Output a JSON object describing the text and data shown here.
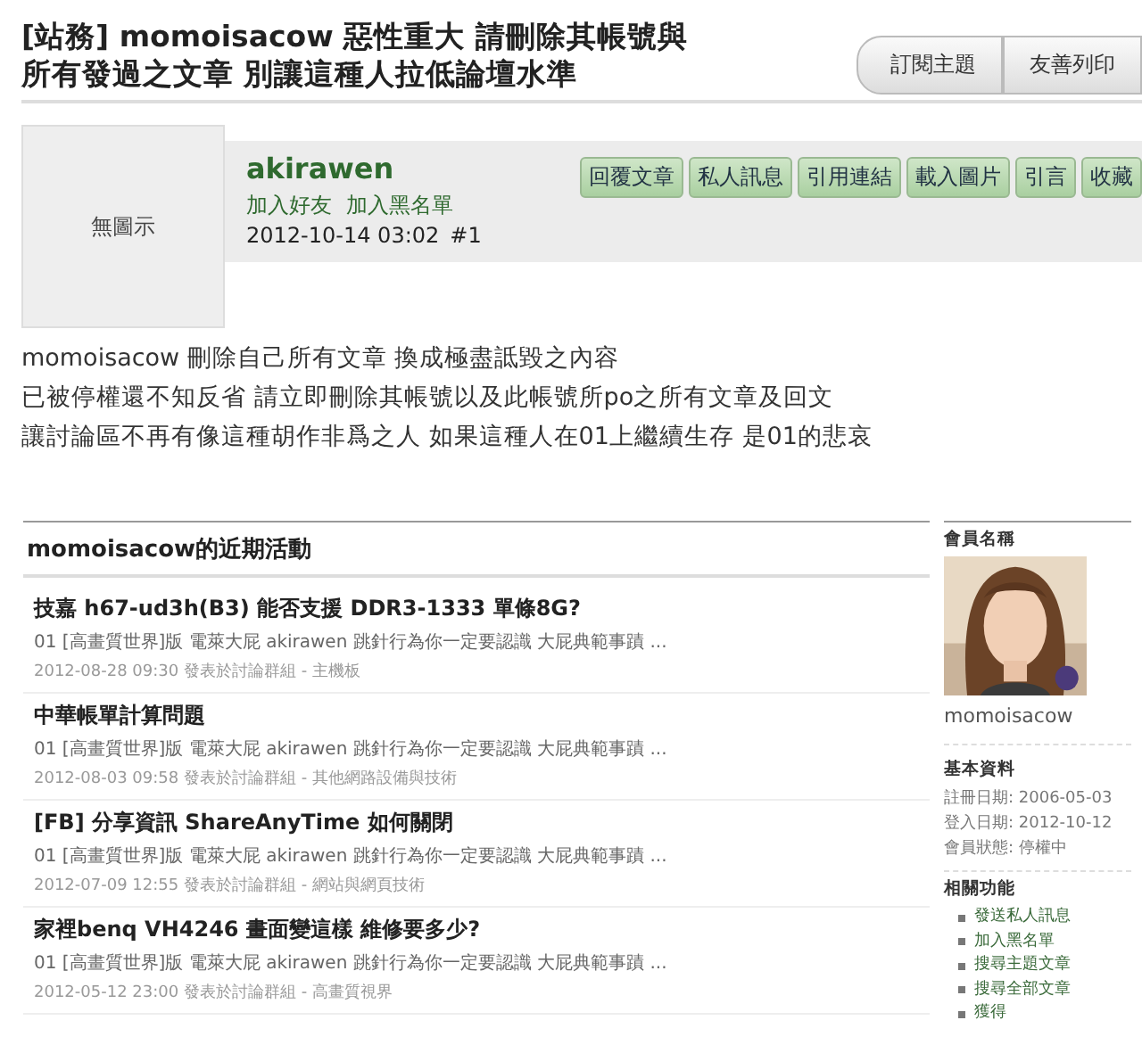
{
  "topic": {
    "title_lines": [
      "[站務] momoisacow 惡性重大 請刪除其帳號與",
      "所有發過之文章 別讓這種人拉低論壇水準"
    ]
  },
  "tabs": [
    {
      "label": "訂閱主題"
    },
    {
      "label": "友善列印"
    }
  ],
  "post": {
    "avatar_text": "無圖示",
    "author": "akirawen",
    "author_links": [
      "加入好友",
      "加入黑名單"
    ],
    "date": "2012-10-14 03:02",
    "number": "#1",
    "actions": [
      "回覆文章",
      "私人訊息",
      "引用連結",
      "載入圖片",
      "引言",
      "收藏"
    ],
    "body": [
      "momoisacow 刪除自己所有文章 換成極盡詆毀之內容",
      "已被停權還不知反省 請立即刪除其帳號以及此帳號所po之所有文章及回文",
      "讓討論區不再有像這種胡作非爲之人 如果這種人在01上繼續生存 是01的悲哀"
    ]
  },
  "activity": {
    "heading": "momoisacow的近期活動",
    "items": [
      {
        "title": "技嘉 h67-ud3h(B3) 能否支援 DDR3-1333 單條8G?",
        "excerpt": "01 [高畫質世界]版 電萊大屁 akirawen 跳針行為你一定要認識 大屁典範事蹟 ...",
        "meta": "2012-08-28 09:30 發表於討論群組 - 主機板"
      },
      {
        "title": "中華帳單計算問題",
        "excerpt": "01 [高畫質世界]版 電萊大屁 akirawen 跳針行為你一定要認識 大屁典範事蹟 ...",
        "meta": "2012-08-03 09:58 發表於討論群組 - 其他網路設備與技術"
      },
      {
        "title": "[FB] 分享資訊 ShareAnyTime 如何關閉",
        "excerpt": "01 [高畫質世界]版 電萊大屁 akirawen 跳針行為你一定要認識 大屁典範事蹟 ...",
        "meta": "2012-07-09 12:55 發表於討論群組 - 網站與網頁技術"
      },
      {
        "title": "家裡benq VH4246 畫面變這樣 維修要多少?",
        "excerpt": "01 [高畫質世界]版 電萊大屁 akirawen 跳針行為你一定要認識 大屁典範事蹟 ...",
        "meta": "2012-05-12 23:00 發表於討論群組 - 高畫質視界"
      }
    ]
  },
  "sidebar": {
    "member_heading": "會員名稱",
    "photo": {
      "kind": "picture"
    },
    "member_name": "momoisacow",
    "info_heading": "基本資料",
    "info": [
      "註冊日期: 2006-05-03",
      "登入日期: 2012-10-12",
      "會員狀態: 停權中"
    ],
    "functions_heading": "相關功能",
    "functions": [
      "發送私人訊息",
      "加入黑名單",
      "搜尋主題文章",
      "搜尋全部文章",
      "獲得"
    ]
  }
}
